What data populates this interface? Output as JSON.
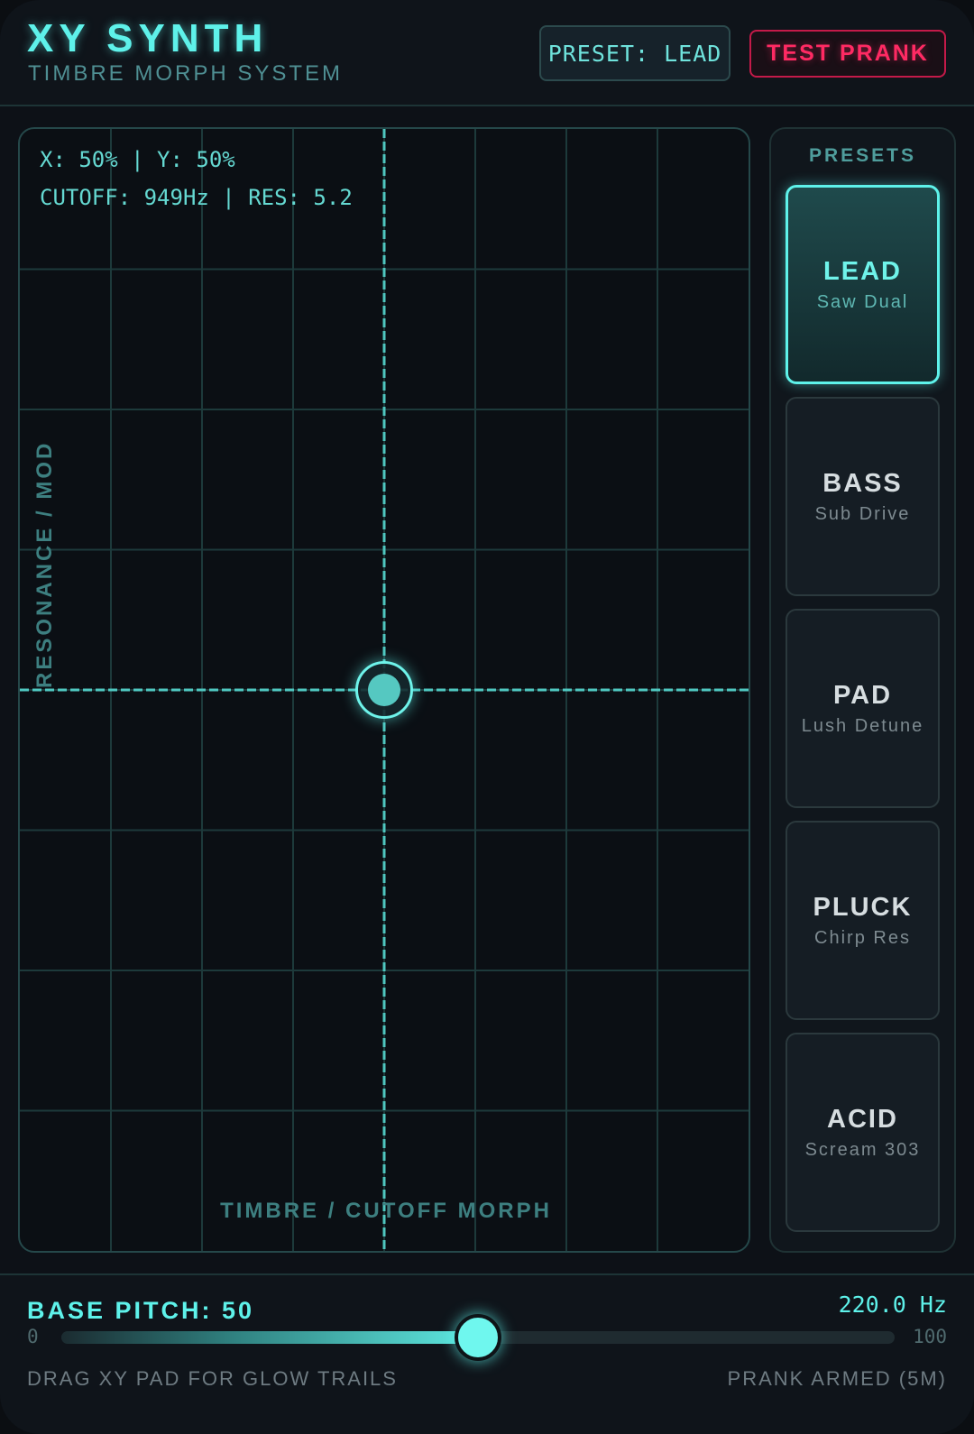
{
  "header": {
    "title": "XY SYNTH",
    "subtitle": "TIMBRE MORPH SYSTEM",
    "preset_badge": "PRESET: LEAD",
    "prank_button": "TEST PRANK"
  },
  "colors": {
    "accent": "#5ef2ea",
    "alert": "#ff2a63",
    "background": "#0d1117"
  },
  "xy_pad": {
    "readout_position": "X: 50% | Y: 50%",
    "readout_params": "CUTOFF: 949Hz | RES: 5.2",
    "x_axis_label": "TIMBRE / CUTOFF MORPH",
    "y_axis_label": "RESONANCE / MOD",
    "x_value": 0.5,
    "y_value": 0.5
  },
  "presets": {
    "title": "PRESETS",
    "items": [
      {
        "name": "LEAD",
        "desc": "Saw Dual",
        "active": true
      },
      {
        "name": "BASS",
        "desc": "Sub Drive",
        "active": false
      },
      {
        "name": "PAD",
        "desc": "Lush Detune",
        "active": false
      },
      {
        "name": "PLUCK",
        "desc": "Chirp Res",
        "active": false
      },
      {
        "name": "ACID",
        "desc": "Scream 303",
        "active": false
      }
    ]
  },
  "footer": {
    "pitch_label": "BASE PITCH: 50",
    "pitch_hz": "220.0 Hz",
    "slider_min": "0",
    "slider_max": "100",
    "slider_value": 50,
    "hint_left": "DRAG XY PAD FOR GLOW TRAILS",
    "hint_right": "PRANK ARMED (5M)"
  }
}
